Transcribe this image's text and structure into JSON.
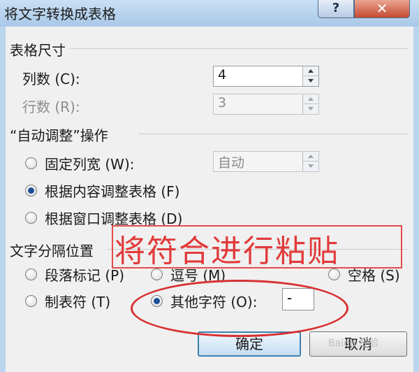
{
  "dialog": {
    "title": "将文字转换成表格",
    "help_glyph": "?",
    "close_glyph": "✕"
  },
  "table_size": {
    "title": "表格尺寸",
    "columns_label": "列数",
    "columns_accel": "(C):",
    "columns_value": "4",
    "rows_label": "行数",
    "rows_accel": "(R):",
    "rows_value": "3"
  },
  "autofit": {
    "title": "“自动调整”操作",
    "fixed_width": {
      "label": "固定列宽",
      "accel": "(W):",
      "checked": false
    },
    "fixed_width_value": "自动",
    "fit_contents": {
      "label": "根据内容调整表格",
      "accel": "(F)",
      "checked": true
    },
    "fit_window": {
      "label": "根据窗口调整表格",
      "accel": "(D)",
      "checked": false
    }
  },
  "separator": {
    "title": "文字分隔位置",
    "paragraph": {
      "label": "段落标记",
      "accel": "(P)",
      "checked": false
    },
    "comma": {
      "label": "逗号",
      "accel": "(M)",
      "checked": false
    },
    "space": {
      "label": "空格",
      "accel": "(S)",
      "checked": false
    },
    "tab": {
      "label": "制表符",
      "accel": "(T)",
      "checked": false
    },
    "other": {
      "label": "其他字符",
      "accel": "(O):",
      "checked": true
    },
    "other_value": "-"
  },
  "buttons": {
    "ok": "确定",
    "cancel": "取消"
  },
  "annotation": {
    "text": "将符合进行粘贴",
    "color": "#e23a3a"
  },
  "watermark": {
    "text": "Baidu 经验"
  },
  "colors": {
    "title_bar": "#a9c8e8",
    "dialog_bg": "#f0f0f0",
    "accent": "#3c7fb1",
    "close_button": "#c74a30"
  },
  "icons": {
    "help": "question-mark-icon",
    "close": "close-icon",
    "spin_up": "arrow-up-icon",
    "spin_down": "arrow-down-icon"
  }
}
